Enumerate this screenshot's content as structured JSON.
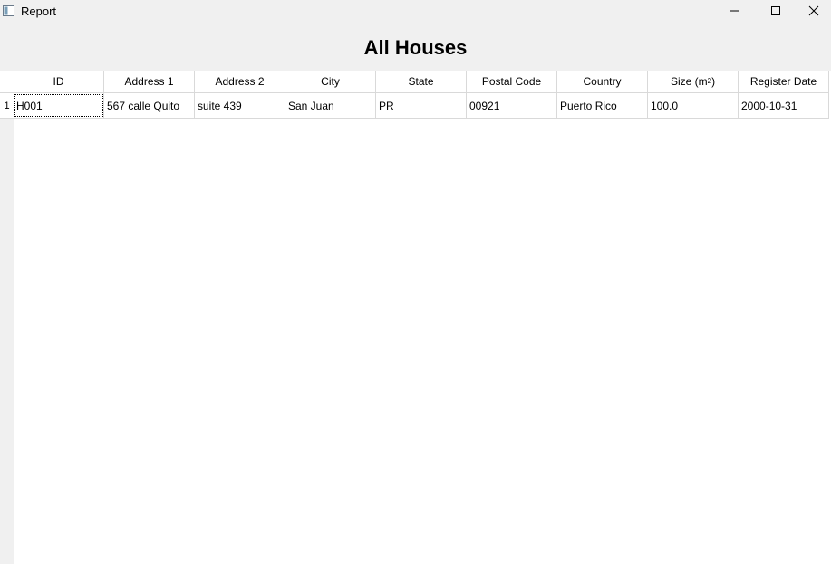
{
  "window": {
    "title": "Report",
    "minimize_icon": "minimize-icon",
    "maximize_icon": "maximize-icon",
    "close_icon": "close-icon"
  },
  "heading": "All Houses",
  "table": {
    "columns": [
      "ID",
      "Address 1",
      "Address 2",
      "City",
      "State",
      "Postal Code",
      "Country",
      "Size (m",
      "Register Date"
    ],
    "size_unit_superscript": "2",
    "size_suffix": ")",
    "rows": [
      {
        "number": "1",
        "cells": [
          "H001",
          "567 calle Quito",
          "suite 439",
          "San Juan",
          "PR",
          "00921",
          "Puerto Rico",
          "100.0",
          "2000-10-31"
        ]
      }
    ]
  }
}
